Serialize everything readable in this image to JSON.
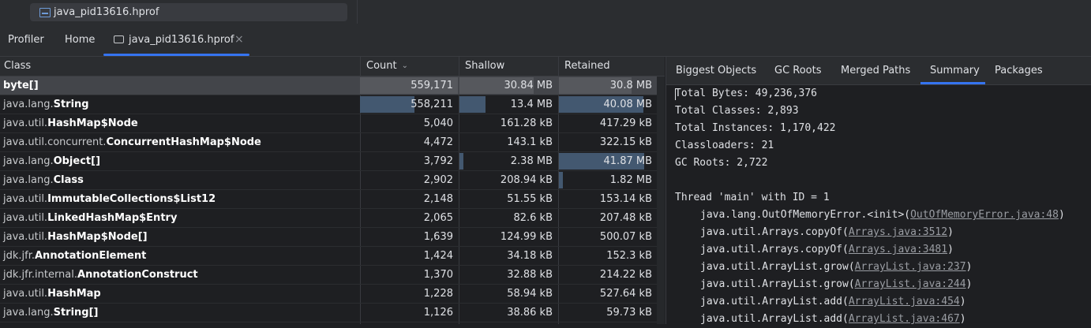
{
  "top_file": {
    "name": "java_pid13616.hprof",
    "icon": "hprof-file-icon"
  },
  "tabs": {
    "profiler": "Profiler",
    "home": "Home",
    "file": "java_pid13616.hprof",
    "close": "×"
  },
  "table": {
    "headers": {
      "class": "Class",
      "count": "Count",
      "shallow": "Shallow",
      "retained": "Retained"
    },
    "rows": [
      {
        "pkg": "",
        "name": "byte[]",
        "count": "559,171",
        "shallow": "30.84 MB",
        "retained": "30.8 MB",
        "count_frac": 1.0,
        "shallow_frac": 0.76,
        "retained_frac": 0.74,
        "selected": true
      },
      {
        "pkg": "java.lang.",
        "name": "String",
        "count": "558,211",
        "shallow": "13.4 MB",
        "retained": "40.08 MB",
        "count_frac": 0.56,
        "shallow_frac": 0.27,
        "retained_frac": 0.86,
        "selected": false
      },
      {
        "pkg": "java.util.",
        "name": "HashMap$Node",
        "count": "5,040",
        "shallow": "161.28 kB",
        "retained": "417.29 kB",
        "count_frac": 0,
        "shallow_frac": 0,
        "retained_frac": 0,
        "selected": false
      },
      {
        "pkg": "java.util.concurrent.",
        "name": "ConcurrentHashMap$Node",
        "count": "4,472",
        "shallow": "143.1 kB",
        "retained": "322.15 kB",
        "count_frac": 0,
        "shallow_frac": 0,
        "retained_frac": 0,
        "selected": false
      },
      {
        "pkg": "java.lang.",
        "name": "Object[]",
        "count": "3,792",
        "shallow": "2.38 MB",
        "retained": "41.87 MB",
        "count_frac": 0,
        "shallow_frac": 0.04,
        "retained_frac": 0.87,
        "selected": false
      },
      {
        "pkg": "java.lang.",
        "name": "Class",
        "count": "2,902",
        "shallow": "208.94 kB",
        "retained": "1.82 MB",
        "count_frac": 0,
        "shallow_frac": 0,
        "retained_frac": 0.04,
        "selected": false
      },
      {
        "pkg": "java.util.",
        "name": "ImmutableCollections$List12",
        "count": "2,148",
        "shallow": "51.55 kB",
        "retained": "153.14 kB",
        "count_frac": 0,
        "shallow_frac": 0,
        "retained_frac": 0,
        "selected": false
      },
      {
        "pkg": "java.util.",
        "name": "LinkedHashMap$Entry",
        "count": "2,065",
        "shallow": "82.6 kB",
        "retained": "207.48 kB",
        "count_frac": 0,
        "shallow_frac": 0,
        "retained_frac": 0,
        "selected": false
      },
      {
        "pkg": "java.util.",
        "name": "HashMap$Node[]",
        "count": "1,639",
        "shallow": "124.99 kB",
        "retained": "500.07 kB",
        "count_frac": 0,
        "shallow_frac": 0,
        "retained_frac": 0,
        "selected": false
      },
      {
        "pkg": "jdk.jfr.",
        "name": "AnnotationElement",
        "count": "1,424",
        "shallow": "34.18 kB",
        "retained": "152.3 kB",
        "count_frac": 0,
        "shallow_frac": 0,
        "retained_frac": 0,
        "selected": false
      },
      {
        "pkg": "jdk.jfr.internal.",
        "name": "AnnotationConstruct",
        "count": "1,370",
        "shallow": "32.88 kB",
        "retained": "214.22 kB",
        "count_frac": 0,
        "shallow_frac": 0,
        "retained_frac": 0,
        "selected": false
      },
      {
        "pkg": "java.util.",
        "name": "HashMap",
        "count": "1,228",
        "shallow": "58.94 kB",
        "retained": "527.64 kB",
        "count_frac": 0,
        "shallow_frac": 0,
        "retained_frac": 0,
        "selected": false
      },
      {
        "pkg": "java.lang.",
        "name": "String[]",
        "count": "1,126",
        "shallow": "38.86 kB",
        "retained": "59.73 kB",
        "count_frac": 0,
        "shallow_frac": 0,
        "retained_frac": 0,
        "selected": false
      }
    ]
  },
  "right_tabs": [
    "Biggest Objects",
    "GC Roots",
    "Merged Paths",
    "Summary",
    "Packages"
  ],
  "active_right_tab": "Summary",
  "summary": {
    "stats": [
      "Total Bytes: 49,236,376",
      "Total Classes: 2,893",
      "Total Instances: 1,170,422",
      "Classloaders: 21",
      "GC Roots: 2,722"
    ],
    "thread_header": "Thread 'main' with ID = 1",
    "frames": [
      {
        "method": "java.lang.OutOfMemoryError.<init>(",
        "link": "OutOfMemoryError.java:48",
        "close": ")"
      },
      {
        "method": "java.util.Arrays.copyOf(",
        "link": "Arrays.java:3512",
        "close": ")"
      },
      {
        "method": "java.util.Arrays.copyOf(",
        "link": "Arrays.java:3481",
        "close": ")"
      },
      {
        "method": "java.util.ArrayList.grow(",
        "link": "ArrayList.java:237",
        "close": ")"
      },
      {
        "method": "java.util.ArrayList.grow(",
        "link": "ArrayList.java:244",
        "close": ")"
      },
      {
        "method": "java.util.ArrayList.add(",
        "link": "ArrayList.java:454",
        "close": ")"
      },
      {
        "method": "java.util.ArrayList.add(",
        "link": "ArrayList.java:467",
        "close": ")"
      }
    ]
  },
  "colors": {
    "accent": "#3574f0",
    "bar": "#435870",
    "selected_row": "#43454a"
  }
}
